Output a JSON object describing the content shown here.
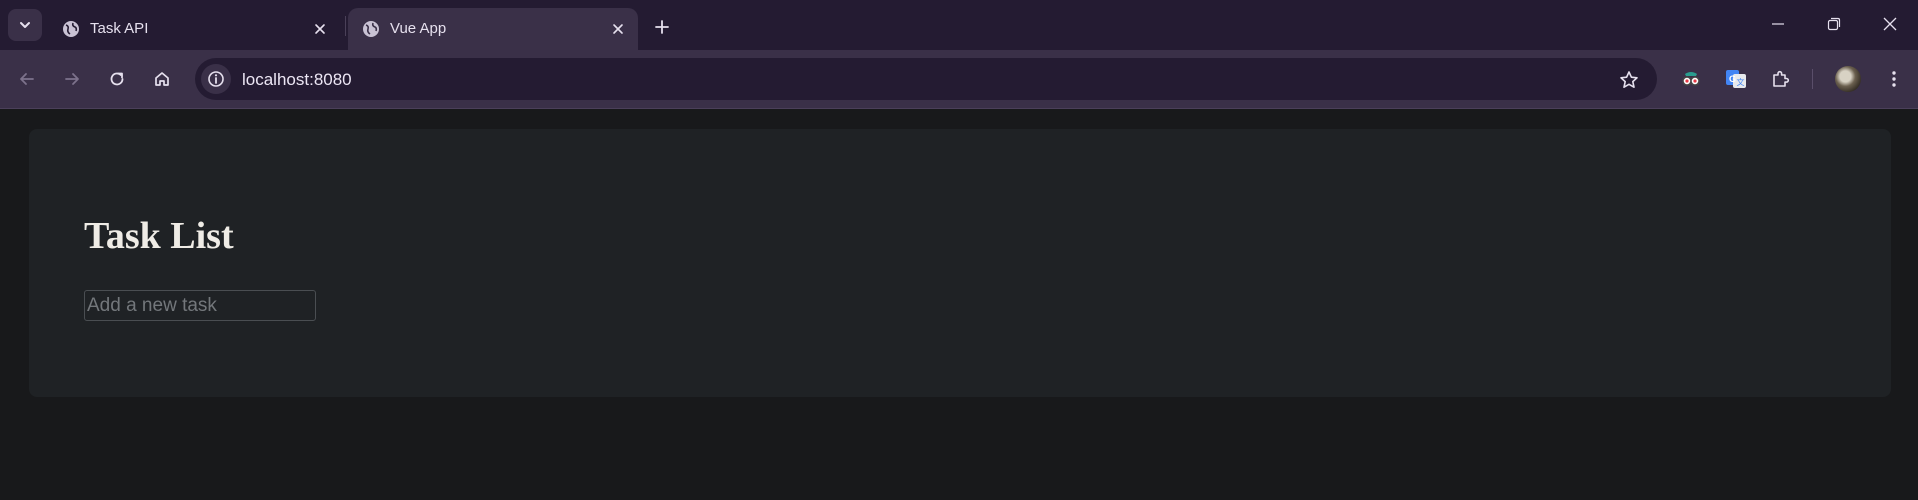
{
  "browser": {
    "tabs": [
      {
        "title": "Task API",
        "icon": "globe-icon",
        "active": false
      },
      {
        "title": "Vue App",
        "icon": "globe-icon",
        "active": true
      }
    ],
    "address_bar": {
      "url": "localhost:8080"
    },
    "extensions": [
      "spy-glasses-icon",
      "google-translate-icon",
      "puzzle-piece-icon"
    ]
  },
  "app": {
    "title": "Task List",
    "new_task_input": {
      "value": "",
      "placeholder": "Add a new task"
    }
  },
  "colors": {
    "titlebar": "#241b32",
    "toolbar": "#3a3048",
    "page_background": "#18191b",
    "card_background": "#1f2225",
    "heading_text": "#efece6"
  }
}
